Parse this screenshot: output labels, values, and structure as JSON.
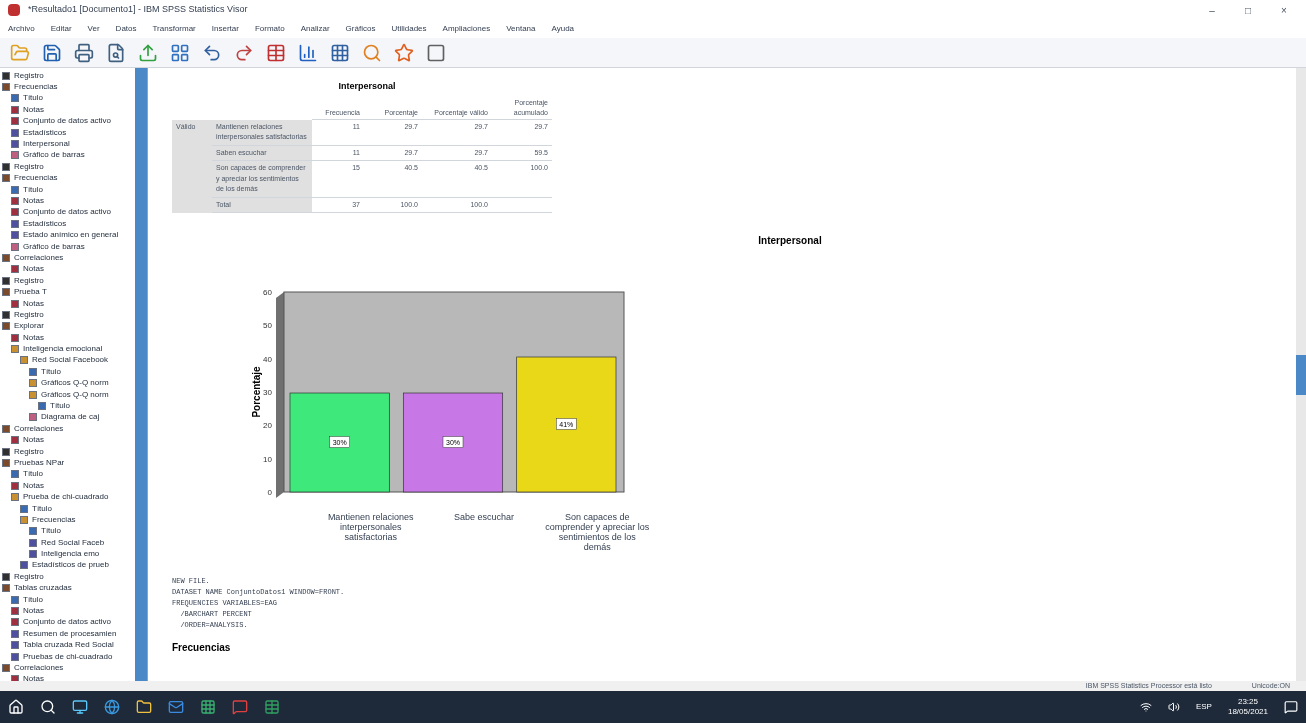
{
  "window": {
    "title": "*Resultado1 [Documento1] - IBM SPSS Statistics Visor",
    "controls": [
      "–",
      "□",
      "×"
    ]
  },
  "menu": [
    "Archivo",
    "Editar",
    "Ver",
    "Datos",
    "Transformar",
    "Insertar",
    "Formato",
    "Analizar",
    "Gráficos",
    "Utilidades",
    "Ampliaciones",
    "Ventana",
    "Ayuda"
  ],
  "outline": [
    {
      "label": "Registro",
      "kind": "log"
    },
    {
      "label": "Frecuencias",
      "kind": "heading",
      "children": [
        {
          "label": "Título",
          "kind": "title"
        },
        {
          "label": "Notas",
          "kind": "notes"
        },
        {
          "label": "Conjunto de datos activo",
          "kind": "notes"
        },
        {
          "label": "Estadísticos",
          "kind": "table"
        },
        {
          "label": "Interpersonal",
          "kind": "table"
        },
        {
          "label": "Gráfico de barras",
          "kind": "chart"
        }
      ]
    },
    {
      "label": "Registro",
      "kind": "log"
    },
    {
      "label": "Frecuencias",
      "kind": "heading",
      "children": [
        {
          "label": "Título",
          "kind": "title"
        },
        {
          "label": "Notas",
          "kind": "notes"
        },
        {
          "label": "Conjunto de datos activo",
          "kind": "notes"
        },
        {
          "label": "Estadísticos",
          "kind": "table"
        },
        {
          "label": "Estado anímico en general",
          "kind": "table"
        },
        {
          "label": "Gráfico de barras",
          "kind": "chart"
        }
      ]
    },
    {
      "label": "Correlaciones",
      "kind": "heading",
      "children": [
        {
          "label": "Notas",
          "kind": "notes"
        }
      ]
    },
    {
      "label": "Registro",
      "kind": "log"
    },
    {
      "label": "Prueba T",
      "kind": "heading",
      "children": [
        {
          "label": "Notas",
          "kind": "notes"
        }
      ]
    },
    {
      "label": "Registro",
      "kind": "log"
    },
    {
      "label": "Explorar",
      "kind": "heading",
      "children": [
        {
          "label": "Notas",
          "kind": "notes"
        },
        {
          "label": "Inteligencia emocional",
          "kind": "folder",
          "children": [
            {
              "label": "Red Social Facebook",
              "kind": "folder",
              "children": [
                {
                  "label": "Título",
                  "kind": "title"
                },
                {
                  "label": "Gráficos Q-Q norm",
                  "kind": "folder"
                },
                {
                  "label": "Gráficos Q-Q norm",
                  "kind": "folder",
                  "children": [
                    {
                      "label": "Título",
                      "kind": "title"
                    }
                  ]
                },
                {
                  "label": "Diagrama de caj",
                  "kind": "chart"
                }
              ]
            }
          ]
        }
      ]
    },
    {
      "label": "Correlaciones",
      "kind": "heading",
      "children": [
        {
          "label": "Notas",
          "kind": "notes"
        }
      ]
    },
    {
      "label": "Registro",
      "kind": "log"
    },
    {
      "label": "Pruebas NPar",
      "kind": "heading",
      "children": [
        {
          "label": "Título",
          "kind": "title"
        },
        {
          "label": "Notas",
          "kind": "notes"
        },
        {
          "label": "Prueba de chi-cuadrado",
          "kind": "folder",
          "children": [
            {
              "label": "Título",
              "kind": "title"
            },
            {
              "label": "Frecuencias",
              "kind": "folder",
              "children": [
                {
                  "label": "Título",
                  "kind": "title"
                },
                {
                  "label": "Red Social Faceb",
                  "kind": "table"
                },
                {
                  "label": "Inteligencia emo",
                  "kind": "table"
                }
              ]
            },
            {
              "label": "Estadísticos de prueb",
              "kind": "table"
            }
          ]
        }
      ]
    },
    {
      "label": "Registro",
      "kind": "log"
    },
    {
      "label": "Tablas cruzadas",
      "kind": "heading",
      "children": [
        {
          "label": "Título",
          "kind": "title"
        },
        {
          "label": "Notas",
          "kind": "notes"
        },
        {
          "label": "Conjunto de datos activo",
          "kind": "notes"
        },
        {
          "label": "Resumen de procesamien",
          "kind": "table"
        },
        {
          "label": "Tabla cruzada Red Social",
          "kind": "table"
        },
        {
          "label": "Pruebas de chi-cuadrado",
          "kind": "table"
        }
      ]
    },
    {
      "label": "Correlaciones",
      "kind": "heading",
      "children": [
        {
          "label": "Notas",
          "kind": "notes"
        }
      ]
    }
  ],
  "table": {
    "title": "Interpersonal",
    "columns": [
      "Frecuencia",
      "Porcentaje",
      "Porcentaje válido",
      "Porcentaje acumulado"
    ],
    "group": "Válido",
    "rows": [
      {
        "label": "Mantienen relaciones interpersonales satisfactorias",
        "cells": [
          "11",
          "29.7",
          "29.7",
          "29.7"
        ]
      },
      {
        "label": "Saben escuchar",
        "cells": [
          "11",
          "29.7",
          "29.7",
          "59.5"
        ]
      },
      {
        "label": "Son capaces de comprender y apreciar los sentimientos de los demás",
        "cells": [
          "15",
          "40.5",
          "40.5",
          "100.0"
        ]
      },
      {
        "label": "Total",
        "cells": [
          "37",
          "100.0",
          "100.0",
          ""
        ]
      }
    ]
  },
  "chart": {
    "chart_data": {
      "type": "bar",
      "title": "Interpersonal",
      "ylabel": "Porcentaje",
      "categories": [
        "Mantienen relaciones interpersonales satisfactorias",
        "Sabe escuchar",
        "Son capaces de comprender y apreciar los sentimientos de los demás"
      ],
      "series": [
        {
          "values": [
            29.7,
            29.7,
            40.5
          ]
        }
      ],
      "colors": [
        "#3ee87a",
        "#c878e6",
        "#e8d818"
      ],
      "ylim": [
        0,
        60
      ],
      "yticks": [
        0,
        10,
        20,
        30,
        40,
        50,
        60
      ],
      "value_labels": [
        "30%",
        "30%",
        "41%"
      ]
    }
  },
  "syntax": [
    "NEW FILE.",
    "DATASET NAME ConjuntoDatos1 WINDOW=FRONT.",
    "FREQUENCIES VARIABLES=EAG",
    "  /BARCHART PERCENT",
    "  /ORDER=ANALYSIS."
  ],
  "next_heading": "Frecuencias",
  "status_bar": {
    "processor": "IBM SPSS Statistics Processor está listo",
    "unicode": "Unicode:ON"
  },
  "taskbar": {
    "language": "ESP",
    "time": "23:25",
    "date": "18/05/2021"
  }
}
